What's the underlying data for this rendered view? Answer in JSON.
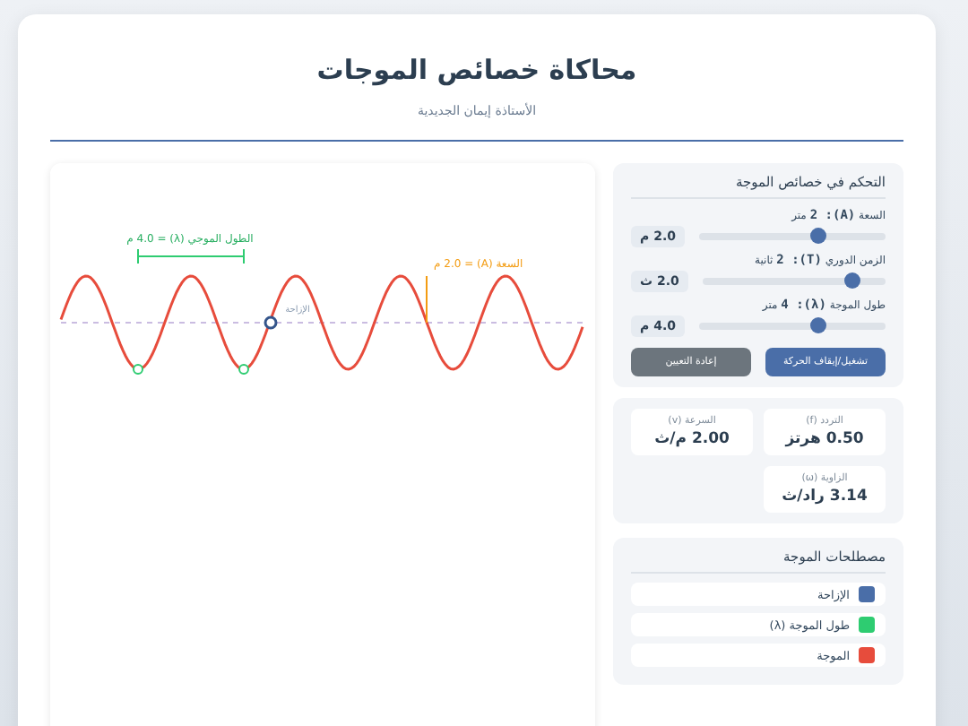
{
  "header": {
    "title": "محاكاة خصائص الموجات",
    "subtitle": "الأستاذة إيمان الجديدية"
  },
  "canvas": {
    "wavelength_label": "الطول الموجي (λ) = 4.0 م",
    "amplitude_label": "السعة (A) = 2.0 م",
    "displacement_label": "الإزاحة"
  },
  "controls": {
    "title": "التحكم في خصائص الموجة",
    "sliders": [
      {
        "label": "السعة **(A): 2** متر",
        "value": "2.0 م",
        "level": 0.64
      },
      {
        "label": "الزمن الدوري **(T): 2** ثانية",
        "value": "2.0 ث",
        "level": 0.82
      },
      {
        "label": "طول الموجة **(λ): 4** متر",
        "value": "4.0 م",
        "level": 0.64
      }
    ],
    "buttons": [
      {
        "label": "تشغيل/إيقاف الحركة",
        "kind": "primary"
      },
      {
        "label": "إعادة التعيين",
        "kind": "secondary"
      }
    ]
  },
  "stats": [
    {
      "label": "التردد (f)",
      "value": "0.50 هرتز"
    },
    {
      "label": "السرعة (v)",
      "value": "2.00 م/ث"
    },
    {
      "label": "الزاوية (ω)",
      "value": "3.14 راد/ث"
    }
  ],
  "legend": {
    "title": "مصطلحات الموجة",
    "items": [
      {
        "label": "الإزاحة",
        "color": "#4a6ea8"
      },
      {
        "label": "طول الموجة (λ)",
        "color": "#2ecc71"
      },
      {
        "label": "الموجة",
        "color": "#e74c3c"
      }
    ]
  }
}
